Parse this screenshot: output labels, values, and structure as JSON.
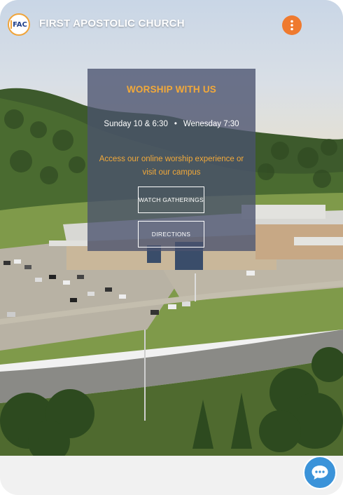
{
  "header": {
    "logo_text": "FAC",
    "site_title": "FIRST APOSTOLIC CHURCH",
    "menu_icon": "kebab-menu-icon"
  },
  "hero": {
    "background": "aerial-church-campus-photo",
    "panel_title": "WORSHIP WITH US",
    "schedule_left": "Sunday 10 & 6:30",
    "schedule_separator": "•",
    "schedule_right": "Wenesday 7:30",
    "tagline": "Access our online worship experience or visit our campus",
    "watch_label": "WATCH GATHERINGS",
    "directions_label": "DIRECTIONS"
  },
  "chat": {
    "icon": "chat-bubble-icon"
  },
  "colors": {
    "accent_orange": "#ef7a2f",
    "title_gold": "#f2a93a",
    "chat_blue": "#3b93d9",
    "panel_bg": "#4a526e"
  }
}
